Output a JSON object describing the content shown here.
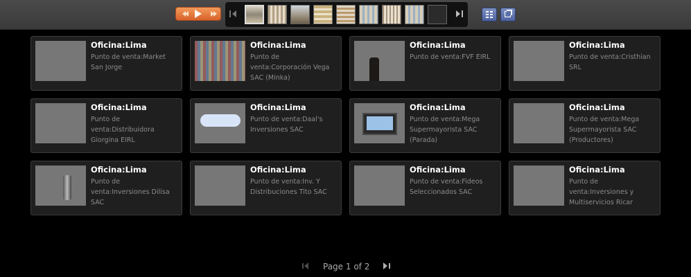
{
  "toolbar": {
    "playback": {
      "rewind_icon": "rewind-icon",
      "play_icon": "play-icon",
      "forward_icon": "fast-forward-icon"
    },
    "strip": {
      "prev_icon": "chevron-left-icon",
      "next_icon": "chevron-right-icon",
      "thumbnail_count": 9,
      "active_index": 0
    },
    "view_buttons": {
      "grid_icon": "grid-view-icon",
      "popout_icon": "open-external-icon"
    }
  },
  "cards": [
    {
      "title": "Oficina:Lima",
      "subtitle": "Punto de venta:Market San Jorge",
      "has_photo": true
    },
    {
      "title": "Oficina:Lima",
      "subtitle": "Punto de venta:Corporación Vega SAC (Minka)",
      "has_photo": true
    },
    {
      "title": "Oficina:Lima",
      "subtitle": "Punto de venta:FVF EIRL",
      "has_photo": true
    },
    {
      "title": "Oficina:Lima",
      "subtitle": "Punto de venta:Cristhian SRL",
      "has_photo": false
    },
    {
      "title": "Oficina:Lima",
      "subtitle": "Punto de venta:Distribuidora Giorgina EIRL",
      "has_photo": false
    },
    {
      "title": "Oficina:Lima",
      "subtitle": "Punto de venta:Daal's Inversiones SAC",
      "has_photo": true
    },
    {
      "title": "Oficina:Lima",
      "subtitle": "Punto de venta:Mega Supermayorista SAC (Parada)",
      "has_photo": true
    },
    {
      "title": "Oficina:Lima",
      "subtitle": "Punto de venta:Mega Supermayorista SAC (Productores)",
      "has_photo": false
    },
    {
      "title": "Oficina:Lima",
      "subtitle": "Punto de venta:Inversiones Dilisa SAC",
      "has_photo": true
    },
    {
      "title": "Oficina:Lima",
      "subtitle": "Punto de venta:Inv. Y Distribuciones Tito SAC",
      "has_photo": false
    },
    {
      "title": "Oficina:Lima",
      "subtitle": "Punto de venta:Fideos Seleccionados SAC",
      "has_photo": false
    },
    {
      "title": "Oficina:Lima",
      "subtitle": "Punto de venta:Inversiones y Multiservicios Ricar",
      "has_photo": false
    }
  ],
  "pager": {
    "label": "Page 1 of 2",
    "current_page": 1,
    "total_pages": 2,
    "prev_icon": "page-prev-icon",
    "next_icon": "page-next-icon"
  },
  "colors": {
    "background": "#000000",
    "toolbar": "#404040",
    "card_bg": "#1f1f1f",
    "card_border": "#3c3c3c",
    "accent_orange": "#e67a3c",
    "accent_blue": "#5a6fa8"
  }
}
